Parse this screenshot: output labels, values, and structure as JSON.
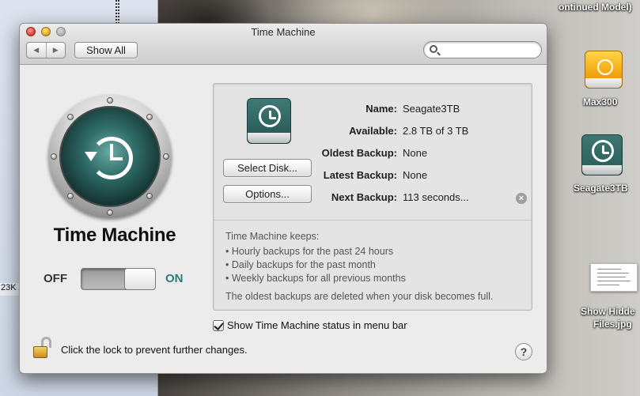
{
  "window": {
    "title": "Time Machine"
  },
  "toolbar": {
    "back_glyph": "◀",
    "forward_glyph": "▶",
    "show_all_label": "Show All",
    "search_placeholder": ""
  },
  "left": {
    "app_name": "Time Machine",
    "toggle_off_label": "OFF",
    "toggle_on_label": "ON",
    "toggle_state": "on"
  },
  "panel": {
    "select_disk_label": "Select Disk...",
    "options_label": "Options...",
    "info": [
      {
        "label": "Name:",
        "value": "Seagate3TB"
      },
      {
        "label": "Available:",
        "value": "2.8 TB of 3 TB"
      },
      {
        "label": "Oldest Backup:",
        "value": "None"
      },
      {
        "label": "Latest Backup:",
        "value": "None"
      },
      {
        "label": "Next Backup:",
        "value": "113 seconds..."
      }
    ],
    "clear_glyph": "×",
    "keeps_title": "Time Machine keeps:",
    "keeps_items": [
      "• Hourly backups for the past 24 hours",
      "• Daily backups for the past month",
      "• Weekly backups for all previous months"
    ],
    "oldest_note": "The oldest backups are deleted when your disk becomes full."
  },
  "checkbox": {
    "label": "Show Time Machine status in menu bar",
    "checked": true
  },
  "footer": {
    "lock_text": "Click the lock to prevent further changes.",
    "help_glyph": "?"
  },
  "desktop": {
    "top_label": "ontinued Model)",
    "left_fragment": "23K /",
    "icons": [
      {
        "name": "Max300",
        "icon": "firewire-drive-icon"
      },
      {
        "name": "Seagate3TB",
        "icon": "time-machine-drive-icon"
      },
      {
        "name_line1": "Show Hidde",
        "name_line2": "Files.jpg",
        "icon": "document-thumbnail-icon"
      }
    ]
  },
  "colors": {
    "on_accent": "#2b7b7b",
    "window_bg": "#ececec"
  }
}
